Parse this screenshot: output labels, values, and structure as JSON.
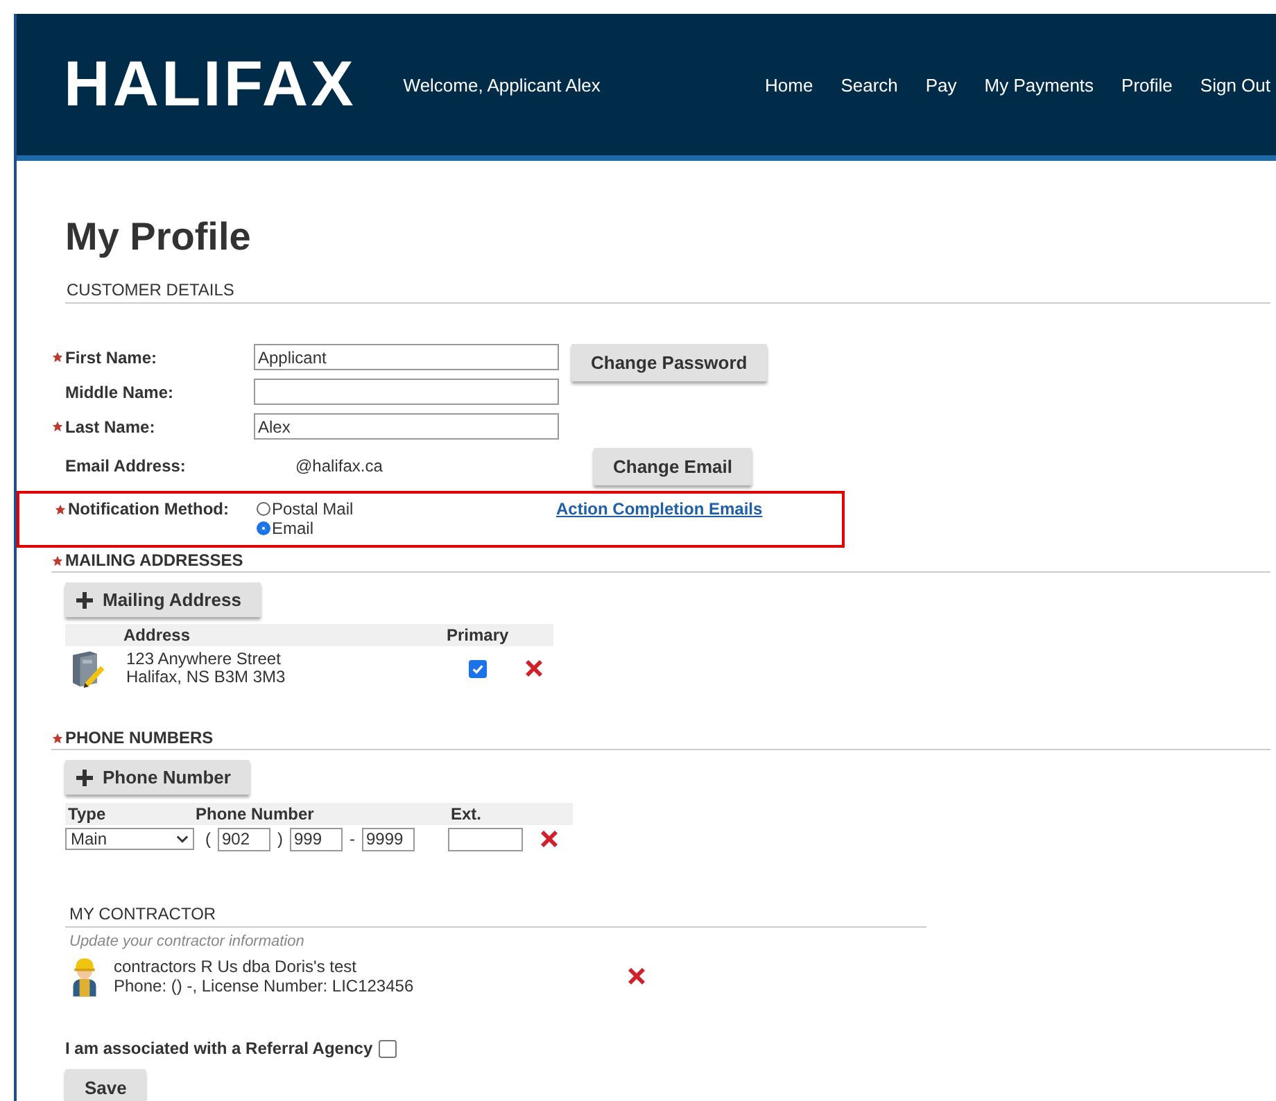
{
  "header": {
    "logo": "HALIFAX",
    "welcome": "Welcome, Applicant Alex",
    "nav": [
      {
        "label": "Home"
      },
      {
        "label": "Search"
      },
      {
        "label": "Pay"
      },
      {
        "label": "My Payments"
      },
      {
        "label": "Profile"
      },
      {
        "label": "Sign Out"
      }
    ]
  },
  "page_title": "My Profile",
  "customer_details": {
    "heading": "CUSTOMER DETAILS",
    "fields": [
      {
        "label": "First Name:",
        "required": true,
        "kind": "input",
        "value": "Applicant",
        "button": "Change Password"
      },
      {
        "label": "Middle Name:",
        "required": false,
        "kind": "input"
      },
      {
        "label": "Last Name:",
        "required": true,
        "kind": "input",
        "value": "Alex"
      },
      {
        "label": "Email Address:",
        "required": false,
        "kind": "text",
        "value": "@halifax.ca",
        "button": "Change Email"
      }
    ],
    "notification": {
      "label": "Notification Method:",
      "required": true,
      "highlighted": true,
      "options": [
        {
          "label": "Postal Mail",
          "selected": false
        },
        {
          "label": "Email",
          "selected": true
        }
      ],
      "link": "Action Completion Emails"
    }
  },
  "mailing": {
    "heading": "MAILING ADDRESSES",
    "required": true,
    "add_button": "Mailing Address",
    "columns": [
      "Address",
      "Primary"
    ],
    "rows": [
      {
        "line1": "123 Anywhere Street",
        "line2": "Halifax, NS B3M 3M3",
        "primary": true
      }
    ]
  },
  "phones": {
    "heading": "PHONE NUMBERS",
    "required": true,
    "add_button": "Phone Number",
    "columns": [
      "Type",
      "Phone Number",
      "Ext."
    ],
    "rows": [
      {
        "type": "Main",
        "open": "(",
        "area": "902",
        "close": ")",
        "prefix": "999",
        "dash": "-",
        "line": "9999"
      }
    ]
  },
  "contractor": {
    "heading": "MY CONTRACTOR",
    "hint": "Update your contractor information",
    "name": "contractors R Us dba Doris's test",
    "details": "Phone: () -, License Number: LIC123456"
  },
  "referral": {
    "label": "I am associated with a Referral Agency",
    "checked": false
  },
  "save": "Save"
}
